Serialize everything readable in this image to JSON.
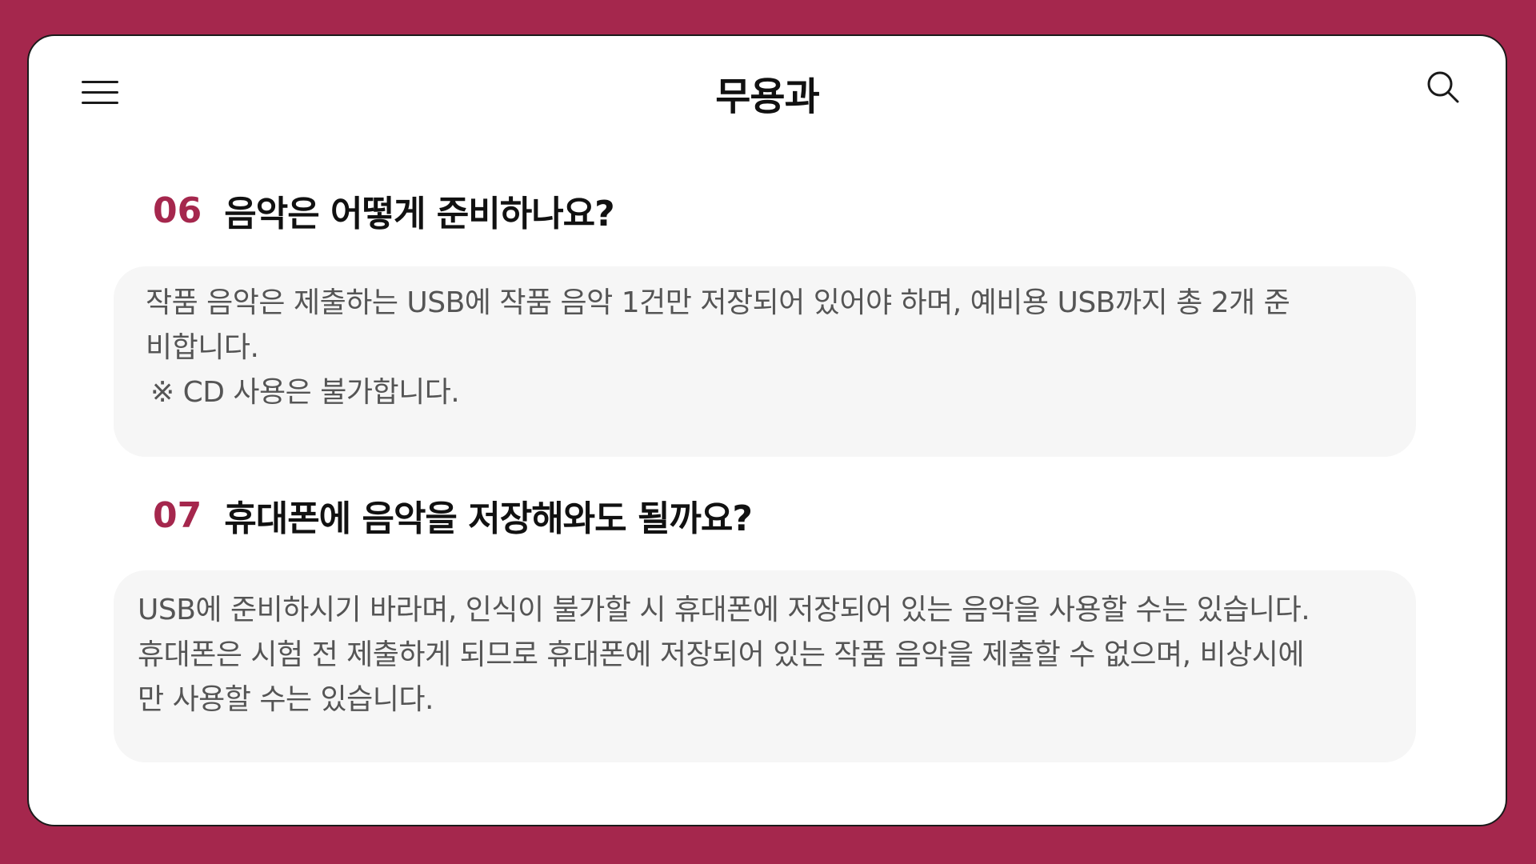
{
  "header": {
    "title": "무용과",
    "menu_icon": "hamburger-menu-icon",
    "search_icon": "search-icon"
  },
  "colors": {
    "background": "#a5274d",
    "accent": "#a5274d",
    "card": "#ffffff",
    "answer_bg": "#f6f6f6"
  },
  "faq": [
    {
      "number": "06",
      "question": "음악은 어떻게 준비하나요?",
      "answer_lines": [
        "작품 음악은 제출하는 USB에 작품 음악 1건만 저장되어 있어야 하며, 예비용 USB까지 총 2개 준",
        "비합니다.",
        "※ CD 사용은 불가합니다."
      ]
    },
    {
      "number": "07",
      "question": "휴대폰에 음악을 저장해와도 될까요?",
      "answer_lines": [
        "USB에 준비하시기 바라며, 인식이 불가할 시 휴대폰에 저장되어 있는 음악을 사용할 수는 있습니다.",
        "휴대폰은 시험 전 제출하게 되므로 휴대폰에 저장되어 있는 작품 음악을 제출할 수 없으며, 비상시에",
        "만 사용할 수는 있습니다."
      ]
    }
  ]
}
